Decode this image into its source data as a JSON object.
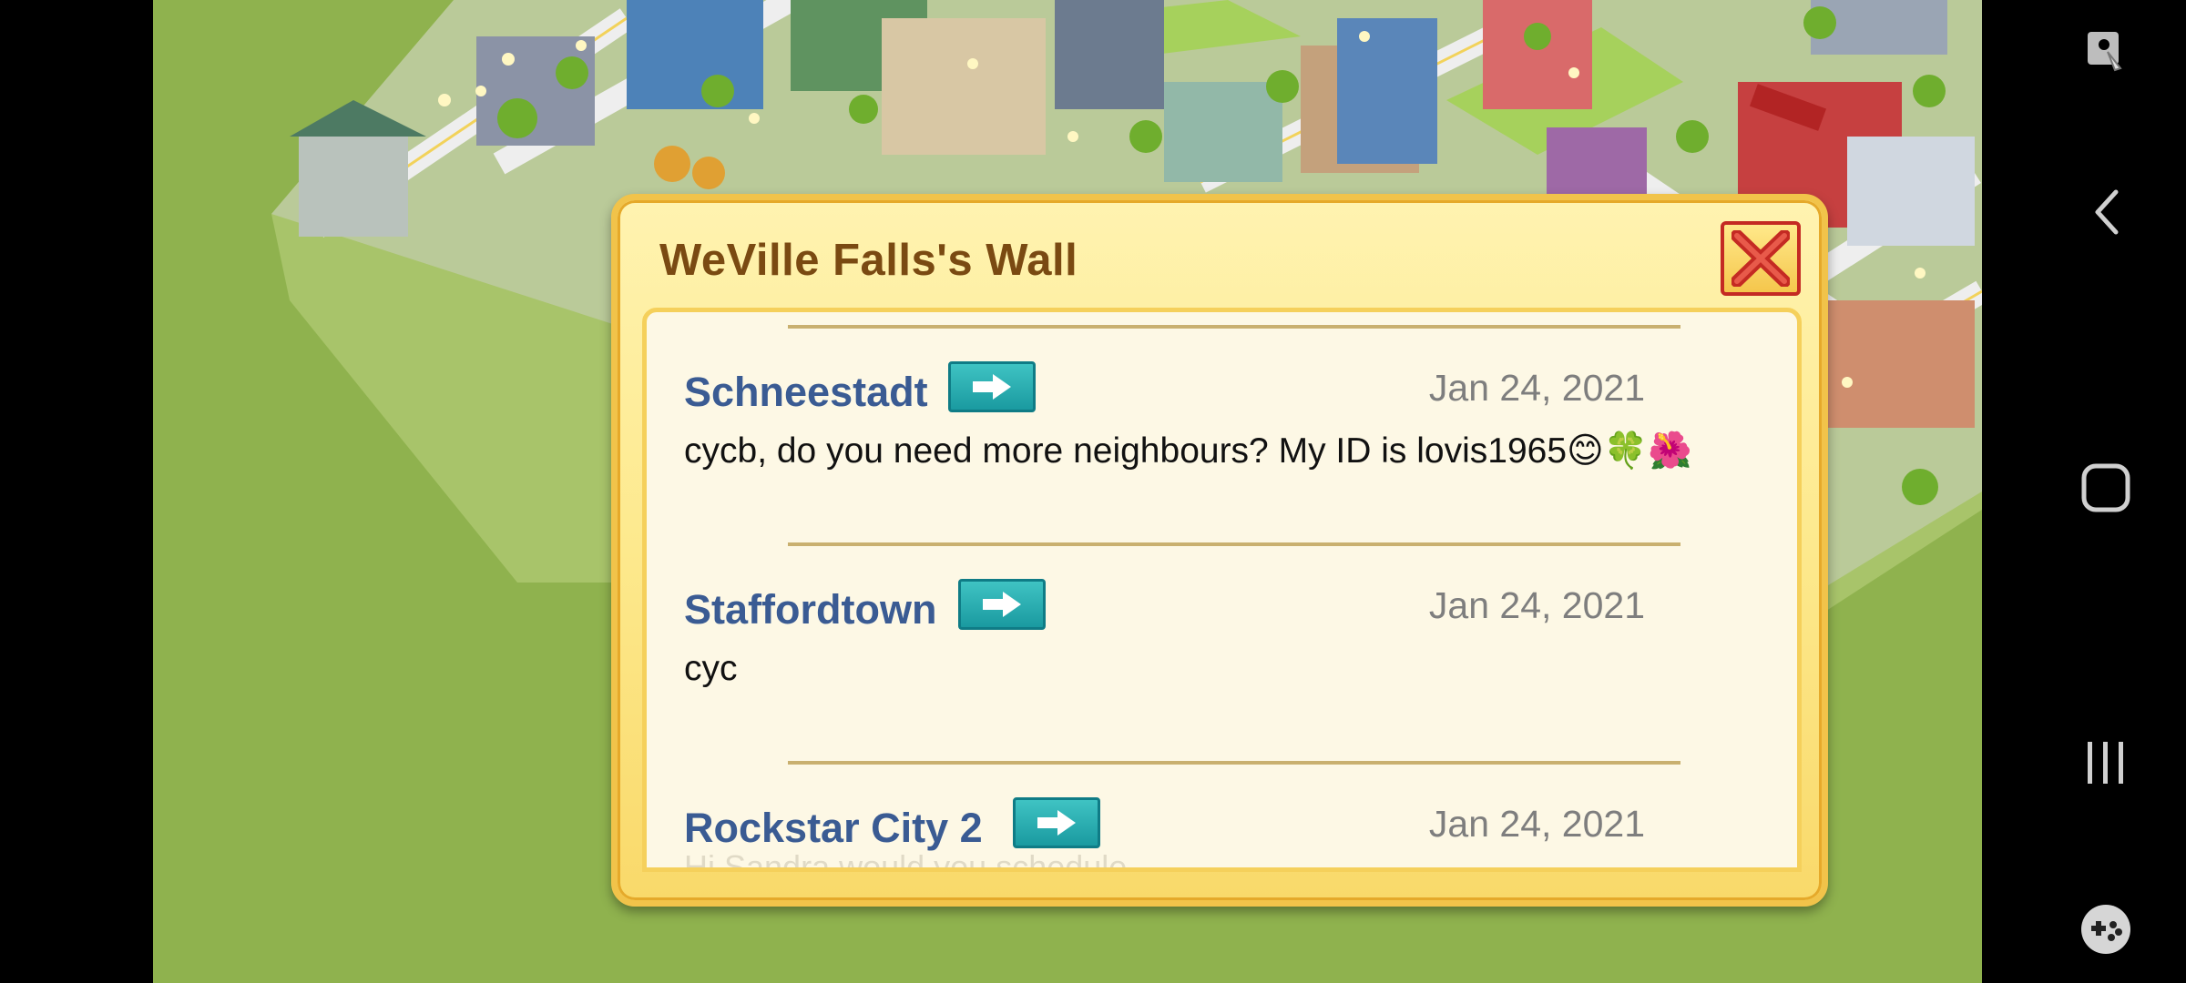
{
  "dialog": {
    "title": "WeVille Falls's Wall",
    "close_icon": "close-x-icon"
  },
  "posts": [
    {
      "name": "Schneestadt",
      "date": "Jan 24, 2021",
      "message": "cycb, do you need more neighbours? My ID is lovis1965😊🍀🌺"
    },
    {
      "name": "Staffordtown",
      "date": "Jan 24, 2021",
      "message": "cyc"
    },
    {
      "name": "Rockstar City 2",
      "date": "Jan 24, 2021",
      "message": "Hi Sandra would you schedule"
    }
  ],
  "nav": {
    "icons": [
      "accessibility-icon",
      "back-icon",
      "home-icon",
      "recents-icon",
      "game-tools-icon"
    ]
  },
  "colors": {
    "grass": "#8fb24e",
    "dialog_border": "#f1c34a",
    "title": "#7a4a12",
    "name": "#3a5b93",
    "visit_button": "#1a9aa0",
    "close_border": "#c42a23"
  }
}
